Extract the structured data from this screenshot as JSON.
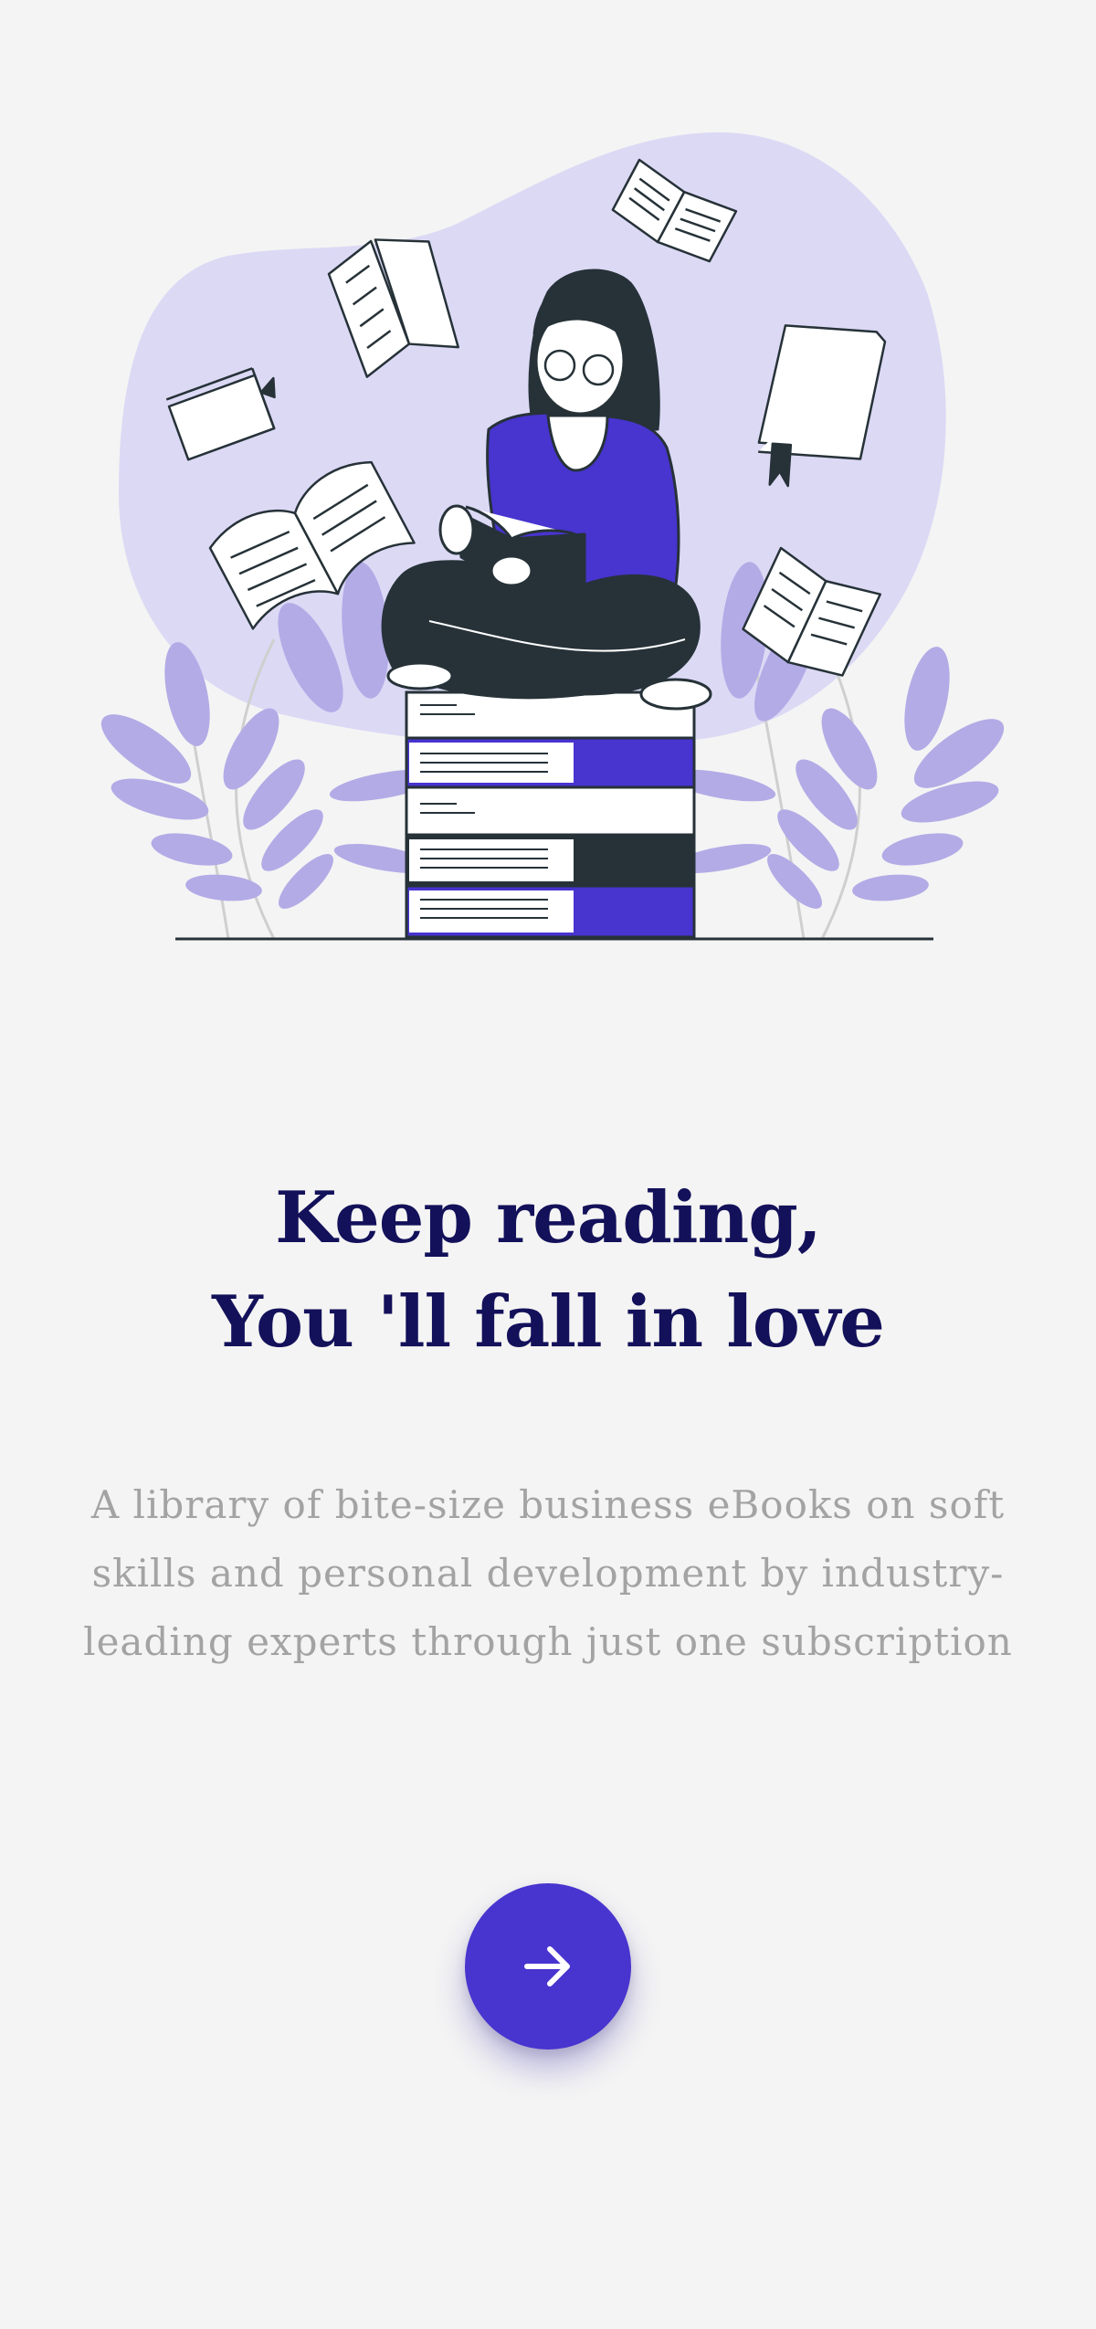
{
  "onboarding": {
    "headline_line1": "Keep reading,",
    "headline_line2": "You 'll fall in love",
    "description": "A library of bite-size business eBooks on soft skills and personal development by industry-leading experts through just one subscription",
    "next_button_icon": "arrow-right-icon"
  },
  "colors": {
    "background": "#f4f4f4",
    "accent": "#4834cf",
    "headline": "#13115a",
    "description": "#a3a3a3",
    "illustration_blob": "#dcd9f5",
    "foliage": "#b3abe6"
  }
}
